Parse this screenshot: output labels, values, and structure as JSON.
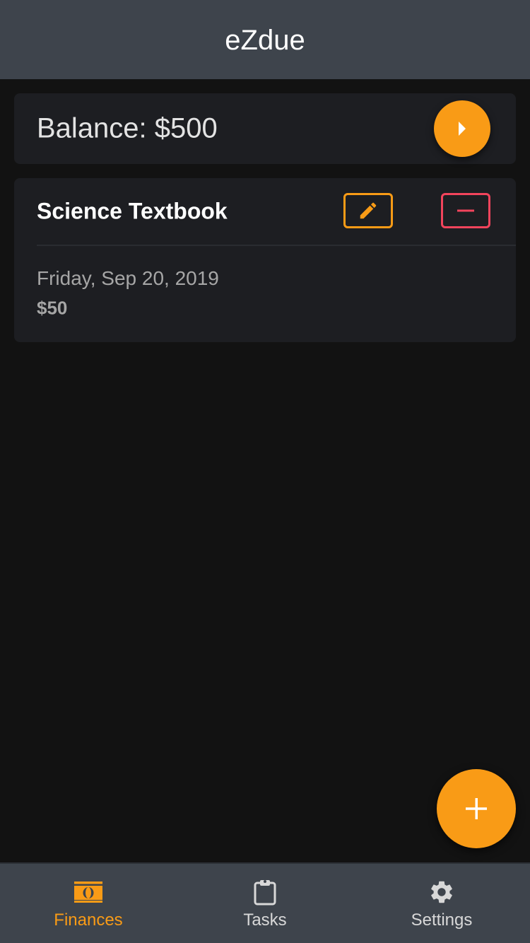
{
  "header": {
    "title": "eZdue"
  },
  "balance": {
    "text": "Balance: $500",
    "action_icon": "play-arrow-icon"
  },
  "items": [
    {
      "title": "Science Textbook",
      "date": "Friday, Sep 20, 2019",
      "amount": "$50",
      "edit_icon": "pencil-icon",
      "delete_icon": "minus-icon"
    }
  ],
  "fab": {
    "icon": "plus-icon"
  },
  "bottom_nav": {
    "items": [
      {
        "label": "Finances",
        "icon": "money-icon",
        "active": true
      },
      {
        "label": "Tasks",
        "icon": "clipboard-icon",
        "active": false
      },
      {
        "label": "Settings",
        "icon": "gear-icon",
        "active": false
      }
    ]
  },
  "colors": {
    "accent": "#f99b16",
    "danger": "#f2445c",
    "header_bg": "#3e444c",
    "card_bg": "#1d1e22",
    "page_bg": "#121212",
    "muted_text": "#a6a6a6"
  }
}
